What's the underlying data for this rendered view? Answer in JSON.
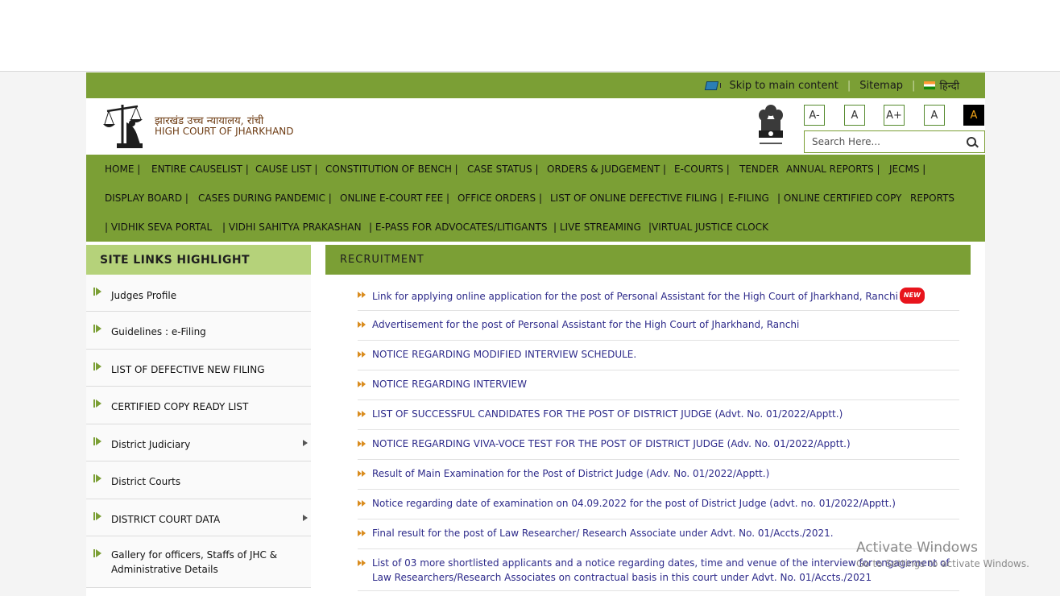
{
  "util_bar": {
    "skip_link": "Skip to main content",
    "sitemap": "Sitemap",
    "language": "हिन्दी"
  },
  "header": {
    "title_hindi": "झारखंड उच्च न्यायालय, रांची",
    "title_english": "HIGH COURT OF JHARKHAND",
    "font_size_buttons": [
      "A-",
      "A",
      "A+",
      "A",
      "A"
    ],
    "search_placeholder": "Search Here..."
  },
  "nav": {
    "items": [
      "HOME |",
      "ENTIRE CAUSELIST |",
      "CAUSE LIST |",
      "CONSTITUTION OF BENCH |",
      "CASE STATUS |",
      "ORDERS & JUDGEMENT |",
      "E-COURTS |",
      "TENDER",
      "ANNUAL REPORTS |",
      "JECMS |",
      "DISPLAY BOARD |",
      "CASES DURING PANDEMIC |",
      "ONLINE E-COURT FEE |",
      "OFFICE ORDERS |",
      "LIST OF ONLINE DEFECTIVE FILING |",
      "E-FILING",
      "| ONLINE CERTIFIED COPY",
      "REPORTS",
      "| VIDHIK SEVA PORTAL",
      "| VIDHI SAHITYA PRAKASHAN",
      "| E-PASS FOR ADVOCATES/LITIGANTS",
      "| LIVE STREAMING",
      "|VIRTUAL JUSTICE CLOCK"
    ]
  },
  "sidebar": {
    "title": "SITE LINKS HIGHLIGHT",
    "items": [
      {
        "label": "Judges Profile",
        "has_submenu": false
      },
      {
        "label": "Guidelines : e-Filing",
        "has_submenu": false
      },
      {
        "label": "LIST OF DEFECTIVE NEW FILING",
        "has_submenu": false
      },
      {
        "label": "CERTIFIED COPY READY LIST",
        "has_submenu": false
      },
      {
        "label": "District Judiciary",
        "has_submenu": true
      },
      {
        "label": "District Courts",
        "has_submenu": false
      },
      {
        "label": "DISTRICT COURT DATA",
        "has_submenu": true
      },
      {
        "label": "Gallery for officers, Staffs of JHC & Administrative Details",
        "has_submenu": false
      }
    ]
  },
  "recruitment": {
    "title": "RECRUITMENT",
    "new_badge": "NEW",
    "items": [
      {
        "text": "Link for applying online application for the post of Personal Assistant for the High Court of Jharkhand, Ranchi",
        "is_new": true
      },
      {
        "text": "Advertisement for the post of Personal Assistant for the High Court of Jharkhand, Ranchi",
        "is_new": false
      },
      {
        "text": "NOTICE REGARDING MODIFIED INTERVIEW SCHEDULE.",
        "is_new": false
      },
      {
        "text": "NOTICE REGARDING INTERVIEW",
        "is_new": false
      },
      {
        "text": "LIST OF SUCCESSFUL CANDIDATES FOR THE POST OF DISTRICT JUDGE (Advt. No. 01/2022/Apptt.)",
        "is_new": false
      },
      {
        "text": "NOTICE REGARDING VIVA-VOCE TEST FOR THE POST OF DISTRICT JUDGE (Adv. No. 01/2022/Apptt.)",
        "is_new": false
      },
      {
        "text": "Result of Main Examination for the Post of District Judge (Adv. No. 01/2022/Apptt.)",
        "is_new": false
      },
      {
        "text": "Notice regarding date of examination on 04.09.2022 for the post of District Judge (advt. no. 01/2022/Apptt.)",
        "is_new": false
      },
      {
        "text": "Final result for the post of Law Researcher/ Research Associate under Advt. No. 01/Accts./2021.",
        "is_new": false
      },
      {
        "text": "List of 03 more shortlisted applicants and a notice regarding dates, time and venue of the interview for engagement of Law Researchers/Research Associates on contractual basis in this court under Advt. No. 01/Accts./2021",
        "is_new": false
      }
    ]
  },
  "watermark": {
    "line1": "Activate Windows",
    "line2": "Go to Settings to activate Windows."
  },
  "colors": {
    "brand_green": "#7b9f35",
    "sidebar_header": "#b5d27a",
    "link_blue": "#2d2a8a",
    "court_title_brown": "#6d3b12"
  }
}
